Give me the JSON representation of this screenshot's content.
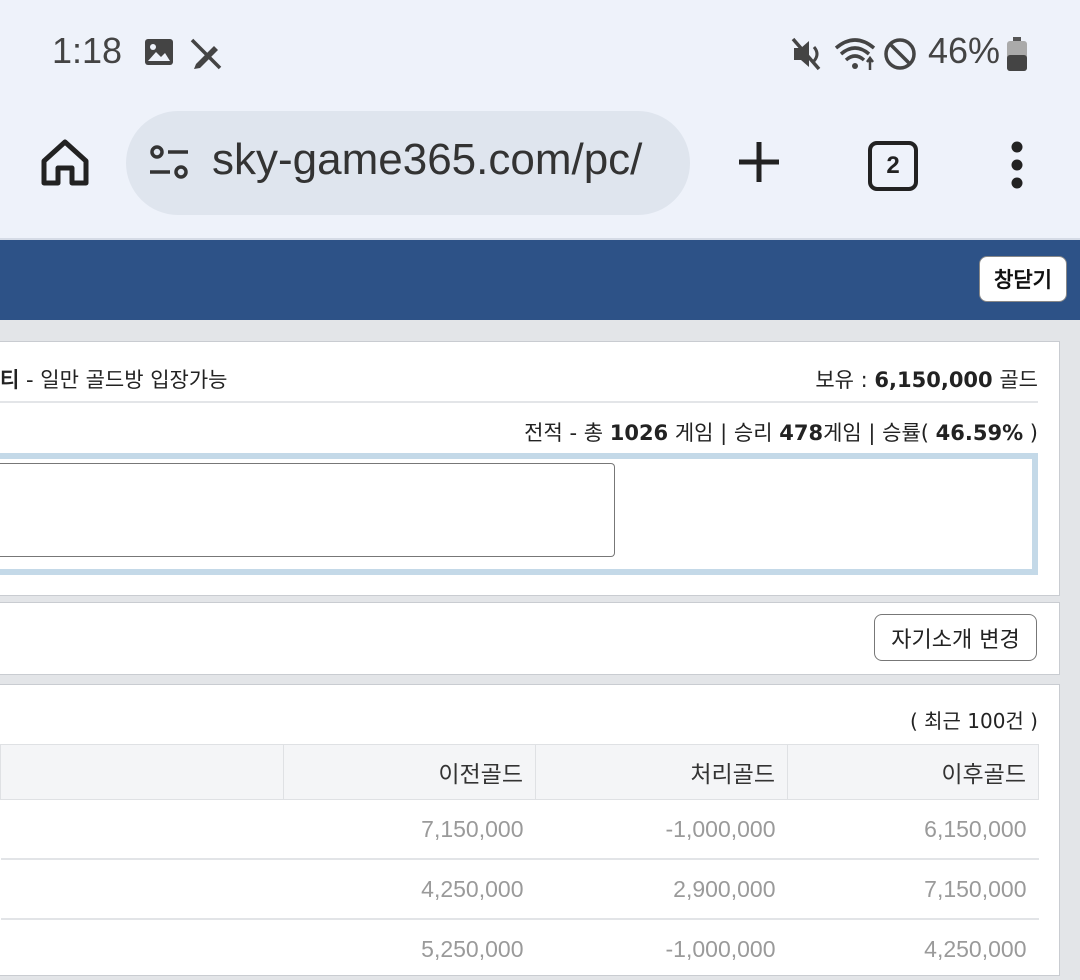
{
  "status_bar": {
    "time": "1:18",
    "icons": [
      "gallery-icon",
      "pen-off-icon",
      "mute-icon",
      "wifi-icon",
      "dnd-icon",
      "battery-icon"
    ],
    "battery": "46%"
  },
  "browser": {
    "url": "sky-game365.com/pc/",
    "tab_count": "2",
    "icons": [
      "home-icon",
      "site-settings-icon",
      "plus-icon",
      "more-vert-icon"
    ]
  },
  "page": {
    "close_button": "창닫기",
    "profile": {
      "grade_suffix": "티",
      "grade_desc": " - 일만 골드방 입장가능",
      "holding_label": "보유 : ",
      "holding_value": "6,150,000",
      "holding_unit": " 골드",
      "record_prefix": "전적 - 총 ",
      "total_games": "1026",
      "games_label": " 게임 | 승리 ",
      "wins": "478",
      "wins_label": "게임 | 승률( ",
      "win_rate": "46.59%",
      "record_suffix": " )"
    },
    "intro_button": "자기소개 변경",
    "history": {
      "recent_label": "( 최근 100건 )",
      "columns": [
        "",
        "이전골드",
        "처리골드",
        "이후골드"
      ],
      "rows": [
        [
          "",
          "7,150,000",
          "-1,000,000",
          "6,150,000"
        ],
        [
          "",
          "4,250,000",
          "2,900,000",
          "7,150,000"
        ],
        [
          "",
          "5,250,000",
          "-1,000,000",
          "4,250,000"
        ]
      ]
    }
  },
  "colors": {
    "header_bar": "#2d5287",
    "browser_bg": "#eef2fa",
    "url_bar": "#dfe5ee",
    "intro_frame": "#c4d9e8"
  }
}
